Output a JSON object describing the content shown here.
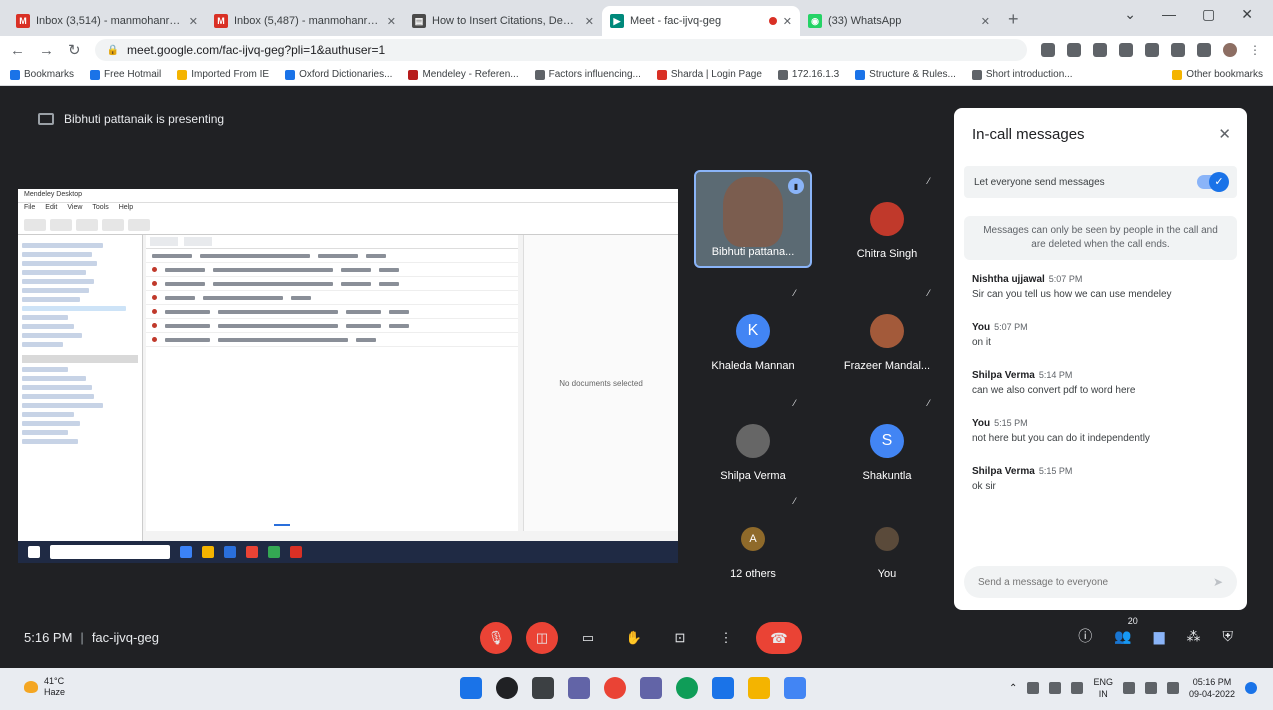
{
  "browser": {
    "tabs": [
      {
        "title": "Inbox (3,514) - manmohanrahul...",
        "favicon": "gmail-icon",
        "color": "#d93025",
        "active": false
      },
      {
        "title": "Inbox (5,487) - manmohanrahul...",
        "favicon": "gmail-icon",
        "color": "#d93025",
        "active": false
      },
      {
        "title": "How to Insert Citations, Develo...",
        "favicon": "doc-icon",
        "color": "#4a4a4a",
        "active": false
      },
      {
        "title": "Meet - fac-ijvq-geg",
        "favicon": "meet-icon",
        "color": "#00897b",
        "active": true
      },
      {
        "title": "(33) WhatsApp",
        "favicon": "whatsapp-icon",
        "color": "#25d366",
        "active": false
      }
    ],
    "url": "meet.google.com/fac-ijvq-geg?pli=1&authuser=1",
    "bookmarks": [
      {
        "label": "Bookmarks",
        "color": "#1a73e8"
      },
      {
        "label": "Free Hotmail",
        "color": "#1a73e8"
      },
      {
        "label": "Imported From IE",
        "color": "#f4b400"
      },
      {
        "label": "Oxford Dictionaries...",
        "color": "#1a73e8"
      },
      {
        "label": "Mendeley - Referen...",
        "color": "#b71c1c"
      },
      {
        "label": "Factors influencing...",
        "color": "#5f6368"
      },
      {
        "label": "Sharda | Login Page",
        "color": "#d93025"
      },
      {
        "label": "172.16.1.3",
        "color": "#5f6368"
      },
      {
        "label": "Structure & Rules...",
        "color": "#1a73e8"
      },
      {
        "label": "Short introduction...",
        "color": "#5f6368"
      }
    ],
    "other_bookmarks": "Other bookmarks"
  },
  "meet": {
    "presenting_text": "Bibhuti pattanaik is presenting",
    "shared_screen": {
      "app_title": "Mendeley Desktop",
      "menu": [
        "File",
        "Edit",
        "View",
        "Tools",
        "Help"
      ],
      "right_pane_text": "No documents selected"
    },
    "participants": [
      {
        "name": "Bibhuti pattana...",
        "type": "video"
      },
      {
        "name": "Chitra Singh",
        "type": "photo",
        "color": "#c0392b",
        "initial": ""
      },
      {
        "name": "Khaleda Mannan",
        "type": "initial",
        "color": "#4285f4",
        "initial": "K"
      },
      {
        "name": "Frazeer Mandal...",
        "type": "photo",
        "color": "#a35a3a",
        "initial": ""
      },
      {
        "name": "Shilpa Verma",
        "type": "photo",
        "color": "#666666",
        "initial": ""
      },
      {
        "name": "Shakuntla",
        "type": "initial",
        "color": "#4285f4",
        "initial": "S"
      },
      {
        "name": "12 others",
        "type": "group",
        "color": "#8f6a2a",
        "initial": "A"
      },
      {
        "name": "You",
        "type": "photo",
        "color": "#5a4a3a",
        "initial": ""
      }
    ],
    "time": "5:16 PM",
    "meeting_code": "fac-ijvq-geg",
    "participant_count": "20"
  },
  "chat": {
    "title": "In-call messages",
    "allow_label": "Let everyone send messages",
    "notice": "Messages can only be seen by people in the call and are deleted when the call ends.",
    "messages": [
      {
        "sender": "Nishtha ujjawal",
        "time": "5:07 PM",
        "text": "Sir can you tell us how we can use mendeley"
      },
      {
        "sender": "You",
        "time": "5:07 PM",
        "text": "on it"
      },
      {
        "sender": "Shilpa Verma",
        "time": "5:14 PM",
        "text": "can we also convert pdf to word here"
      },
      {
        "sender": "You",
        "time": "5:15 PM",
        "text": "not here but you can do it independently"
      },
      {
        "sender": "Shilpa Verma",
        "time": "5:15 PM",
        "text": "ok sir"
      }
    ],
    "placeholder": "Send a message to everyone"
  },
  "taskbar": {
    "weather_temp": "41°C",
    "weather_desc": "Haze",
    "lang_top": "ENG",
    "lang_bottom": "IN",
    "clock_time": "05:16 PM",
    "clock_date": "09-04-2022"
  }
}
